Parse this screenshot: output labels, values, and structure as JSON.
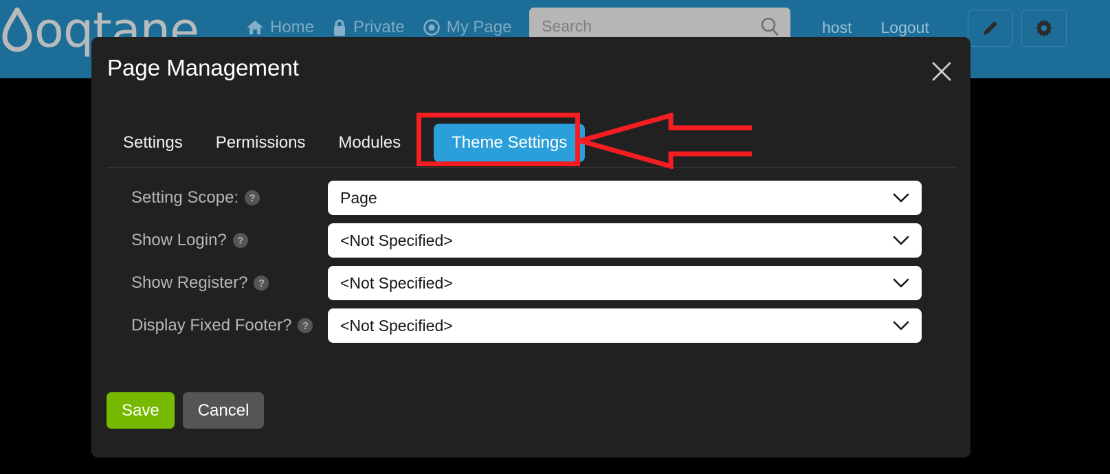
{
  "header": {
    "brand": {
      "name": "oqtane",
      "logo_icon": "water-drop-icon"
    },
    "nav": [
      {
        "label": "Home",
        "icon": "home-icon"
      },
      {
        "label": "Private",
        "icon": "lock-icon"
      },
      {
        "label": "My Page",
        "icon": "target-icon"
      }
    ],
    "search": {
      "placeholder": "Search",
      "value": "",
      "icon": "search-icon"
    },
    "user": "host",
    "logout": "Logout",
    "actions": [
      {
        "name": "edit-button",
        "icon": "pencil-icon"
      },
      {
        "name": "settings-button",
        "icon": "gear-icon"
      }
    ],
    "colors": {
      "background": "#1c6e99",
      "text": "#7fa9c2"
    }
  },
  "modal": {
    "title": "Page Management",
    "close_icon": "close-icon",
    "tabs": [
      {
        "label": "Settings",
        "active": false
      },
      {
        "label": "Permissions",
        "active": false
      },
      {
        "label": "Modules",
        "active": false
      },
      {
        "label": "Theme Settings",
        "active": true
      }
    ],
    "active_tab": "Theme Settings",
    "form": [
      {
        "label": "Setting Scope:",
        "help_icon": "help-circle-icon",
        "value": "Page",
        "chevron_icon": "chevron-down-icon"
      },
      {
        "label": "Show Login?",
        "help_icon": "help-circle-icon",
        "value": "<Not Specified>",
        "chevron_icon": "chevron-down-icon"
      },
      {
        "label": "Show Register?",
        "help_icon": "help-circle-icon",
        "value": "<Not Specified>",
        "chevron_icon": "chevron-down-icon"
      },
      {
        "label": "Display Fixed Footer?",
        "help_icon": "help-circle-icon",
        "value": "<Not Specified>",
        "chevron_icon": "chevron-down-icon"
      }
    ],
    "footer": {
      "save_label": "Save",
      "cancel_label": "Cancel"
    },
    "colors": {
      "background": "#212121",
      "active_tab": "#2b9fd9",
      "save": "#76b900",
      "cancel": "#555555"
    }
  },
  "annotation": {
    "highlight_target": "Theme Settings",
    "shape": "arrow-left-outline",
    "color": "#f41e22"
  }
}
